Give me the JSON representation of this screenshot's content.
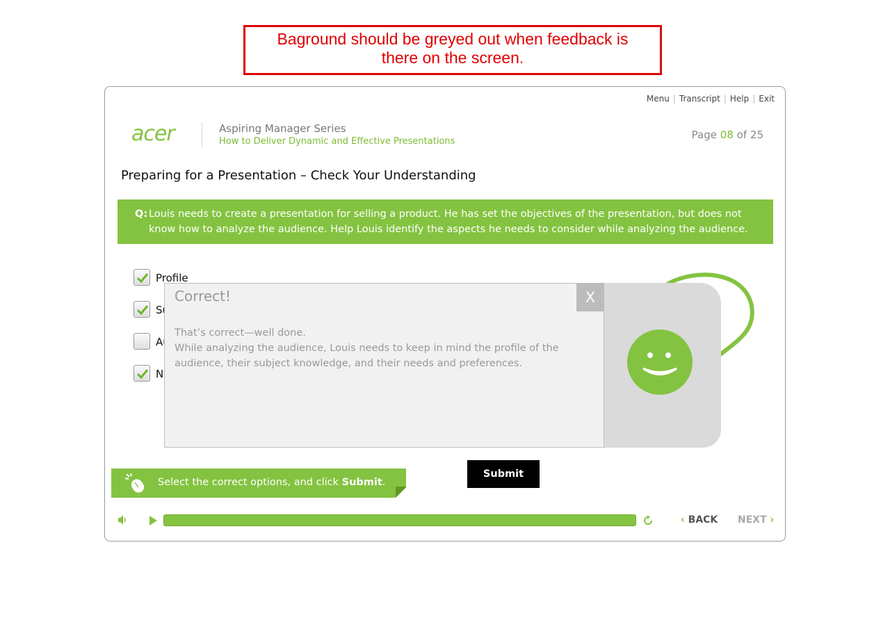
{
  "annotation": {
    "line1": "Baground should be greyed out when feedback is",
    "line2": "there on the screen."
  },
  "topnav": {
    "menu": "Menu",
    "transcript": "Transcript",
    "help": "Help",
    "exit": "Exit",
    "separator": "|"
  },
  "header": {
    "logo_text": "acer",
    "series": "Aspiring Manager Series",
    "course": "How to Deliver Dynamic and Effective Presentations",
    "page_prefix": "Page",
    "page_current": "08",
    "page_of": "of",
    "page_total": "25"
  },
  "page_title": "Preparing for a Presentation – Check Your Understanding",
  "question": {
    "prefix": "Q:",
    "text": "Louis needs to create a presentation for selling a product. He has set the objectives of the presentation, but does not know how to analyze the audience. Help Louis identify the aspects he needs to consider while analyzing the audience."
  },
  "options": [
    {
      "label": "Profile",
      "checked": true
    },
    {
      "label": "Su",
      "checked": true
    },
    {
      "label": "Au",
      "checked": false
    },
    {
      "label": "Ne",
      "checked": true
    }
  ],
  "feedback": {
    "title": "Correct!",
    "close_label": "X",
    "line1": "That’s correct—well done.",
    "line2": "While analyzing the audience, Louis needs to keep in mind the profile of the audience, their subject knowledge, and their needs and preferences."
  },
  "instruction": {
    "text": "Select the correct options, and click ",
    "bold": "Submit",
    "end": "."
  },
  "submit_label": "Submit",
  "player": {
    "back_label": "BACK",
    "next_label": "NEXT",
    "progress": 1.0
  },
  "colors": {
    "accent": "#84c341",
    "annotation": "#e00000",
    "panel": "#f1f1f1"
  }
}
